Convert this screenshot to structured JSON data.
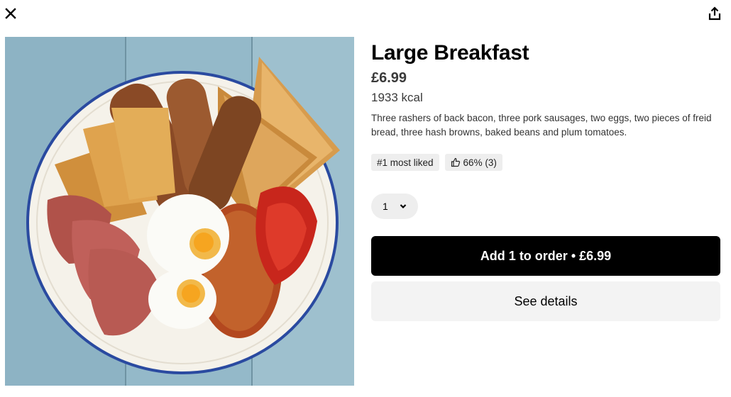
{
  "header": {
    "close_icon": "close-icon",
    "share_icon": "share-icon"
  },
  "item": {
    "title": "Large Breakfast",
    "price": "£6.99",
    "calories": "1933 kcal",
    "description": "Three rashers of back bacon, three pork sausages, two eggs, two pieces of freid bread, three hash browns, baked beans and plum tomatoes.",
    "image_alt": "Large Breakfast"
  },
  "badges": {
    "rank": "#1 most liked",
    "rating": "66% (3)",
    "rating_icon": "thumbs-up-icon"
  },
  "quantity": {
    "value": "1",
    "icon": "chevron-down-icon"
  },
  "actions": {
    "add_label": "Add 1 to order • £6.99",
    "details_label": "See details"
  },
  "colors": {
    "primary_button": "#000000",
    "secondary_button": "#f3f3f3",
    "badge_bg": "#eeeeee"
  }
}
